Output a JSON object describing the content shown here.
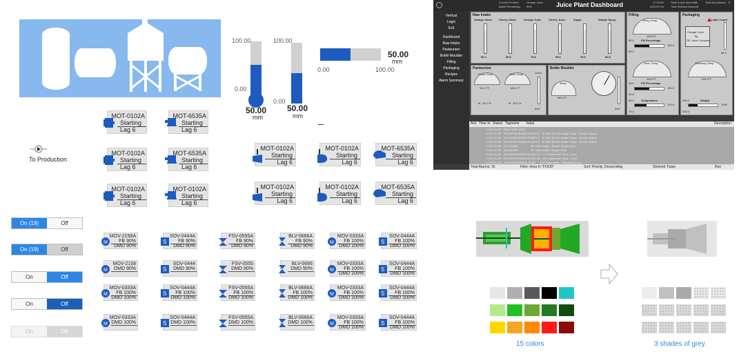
{
  "tanks": {
    "bg": "#87b8ee"
  },
  "level_vertical_1": {
    "top": "100.00",
    "bottom": "0.00",
    "value": "50.00",
    "unit": "mm",
    "fill": 0.5
  },
  "level_vertical_2": {
    "top": "100.00",
    "bottom": "0.00",
    "value": "50.00",
    "unit": "mm",
    "fill": 0.5
  },
  "level_horizontal": {
    "left": "0.00",
    "right": "100.00",
    "value": "50.00",
    "unit": "mm",
    "fill": 0.5
  },
  "to_production": {
    "label": "To Production"
  },
  "motors": [
    {
      "tag": "MOT-0102A",
      "status": "Starting",
      "lag": "Lag 6"
    },
    {
      "tag": "MOT-6535A",
      "status": "Starting",
      "lag": "Lag 6"
    },
    {
      "tag": "MOT-0102A",
      "status": "Starting",
      "lag": "Lag 6"
    },
    {
      "tag": "MOT-6535A",
      "status": "Starting",
      "lag": "Lag 6"
    },
    {
      "tag": "MOT-0102A",
      "status": "Starting",
      "lag": "Lag 6"
    },
    {
      "tag": "MOT-0102A",
      "status": "Starting",
      "lag": "Lag 6"
    },
    {
      "tag": "MOT-0102A",
      "status": "Starting",
      "lag": "Lag 6"
    },
    {
      "tag": "MOT-0102A",
      "status": "Starting",
      "lag": "Lag 6"
    },
    {
      "tag": "MOT-6535A",
      "status": "Starting",
      "lag": "Lag 6"
    },
    {
      "tag": "MOT-0102A",
      "status": "Starting",
      "lag": "Lag 6"
    },
    {
      "tag": "MOT-0102A",
      "status": "Starting",
      "lag": "Lag 6"
    },
    {
      "tag": "MOT-6535A",
      "status": "Starting",
      "lag": "Lag 6"
    }
  ],
  "toggles": [
    {
      "on": "On (19)",
      "off": "Off"
    },
    {
      "on": "On (19)",
      "off": "Off"
    },
    {
      "on": "On",
      "off": "Off"
    },
    {
      "on": "On",
      "off": "Off"
    },
    {
      "on": "On",
      "off": "Off"
    }
  ],
  "valves_row1": [
    {
      "tag": "MOV-2158A",
      "fb": "FB 90%",
      "dmd": "DMD 90%"
    },
    {
      "tag": "SOV-0444A",
      "fb": "FB 90%",
      "dmd": "DMD 90%"
    },
    {
      "tag": "FSV-0555A",
      "fb": "FB 90%",
      "dmd": "DMD 90%"
    },
    {
      "tag": "BLV-0666A",
      "fb": "FB 90%",
      "dmd": "DMD 90%"
    },
    {
      "tag": "MOV-0333A",
      "fb": "FB 100%",
      "dmd": "DMD 100%"
    },
    {
      "tag": "SOV-0444A",
      "fb": "FB 100%",
      "dmd": "DMD 100%"
    }
  ],
  "valves_row2": [
    {
      "tag": "MOV-2158",
      "fb": "DMD 90%"
    },
    {
      "tag": "SOV-0444",
      "fb": "DMD 90%"
    },
    {
      "tag": "FSV-0555",
      "fb": "DMD 90%"
    },
    {
      "tag": "BLV-0666",
      "fb": "DMD 90%"
    },
    {
      "tag": "MOV-0333A",
      "fb": "FB 100%",
      "dmd": "DMD 100%"
    },
    {
      "tag": "SOV-0444A",
      "fb": "FB 100%",
      "dmd": "DMD 100%"
    }
  ],
  "valves_row3": [
    {
      "tag": "MOV-0333A",
      "fb": "FB 100%",
      "dmd": "DMD 100%"
    },
    {
      "tag": "SOV-0444A",
      "fb": "FB 100%",
      "dmd": "DMD 100%"
    },
    {
      "tag": "FSV-0555A",
      "fb": "FB 100%",
      "dmd": "DMD 100%"
    },
    {
      "tag": "BLV-0666A",
      "fb": "FB 100%",
      "dmd": "DMD 100%"
    },
    {
      "tag": "MOV-0333A",
      "fb": "FB 100%",
      "dmd": "DMD 100%"
    },
    {
      "tag": "SOV-0444A",
      "fb": "FB 100%",
      "dmd": "DMD 100%"
    }
  ],
  "valves_row4": [
    {
      "tag": "MOV-0333A",
      "fb": "DMD 100%"
    },
    {
      "tag": "SOV-0444A",
      "fb": "DMD 100%"
    },
    {
      "tag": "FSV-0555A",
      "fb": "DMD 100%"
    },
    {
      "tag": "BLV-0666A",
      "fb": "DMD 100%"
    },
    {
      "tag": "MOV-0333A",
      "fb": "FB 100%",
      "dmd": "DMD 100%"
    },
    {
      "tag": "SOV-0444A",
      "fb": "FB 100%",
      "dmd": "DMD 100%"
    }
  ],
  "dashboard": {
    "title": "Juice Plant Dashboard",
    "product_label": "Current Product:",
    "product": "Orange Juice",
    "batch_label": "Batch Remaining:",
    "batch": "90%",
    "time": "17:04:58",
    "date": "2021/07/14",
    "unack_label": "Total Unack Alarms:",
    "unack": "16",
    "shelved_label": "Total Shelved Alarms:",
    "shelved": "0",
    "ack_label": "Total Ack Alarms:",
    "ack": "0",
    "nav": [
      "Vertical",
      "Login",
      "Exit",
      "Dashboard",
      "Raw Intake",
      "Pasteurizer",
      "Bottle Moulder",
      "Filling",
      "Packaging",
      "Recipes",
      "Alarm Summary"
    ],
    "raw_intake": "Raw Intake",
    "raw_tanks": [
      {
        "name": "Orange Share",
        "val": "80.4"
      },
      {
        "name": "Cherry Share",
        "val": "95.6"
      },
      {
        "name": "Orange Juice",
        "val": "79.8"
      },
      {
        "name": "Cherry Juice",
        "val": "95.6"
      },
      {
        "name": "Sugar",
        "val": "95.6"
      },
      {
        "name": "Simple Syrup",
        "val": "80.8"
      }
    ],
    "filling": "Filling",
    "packaging": "Packaging",
    "slurry_temp": "Slurry Temp",
    "slurry_val": "106.9°F",
    "fill_pct": "Fill Percentage",
    "fill_left": "50.0",
    "fill_right": "100.0",
    "fill_bot": "50.0",
    "label_count": "Label Count",
    "label_box": "Orange Juice",
    "label_by": "By",
    "label_co": "GE Juice Company",
    "label_val": "86.9",
    "juice_temp": "Juice Temp",
    "juice_val": "106.9°F",
    "fill2_left": "49.0",
    "fill2_right": "100.0",
    "fill2_bot": "50.0",
    "shrink_temp": "Shrinking Temp",
    "shrink_val": "209.2°F",
    "temperature": "Temperature",
    "temp_left": "66.0",
    "temp_right": "120.0",
    "temp_bot": "70.0",
    "weight": "Weight",
    "weight_left": "296.2",
    "weight_right": "1000",
    "weight_bot": "200.0",
    "pasteurizer": "Pasteurizer",
    "bottle_moulder": "Bottle Moulder",
    "past_slurry": "Slurry Temp",
    "past_slurry_val": "191.1°F",
    "past_juice": "Juice Temp",
    "past_juice_val": "186.1°F",
    "past_level": "Level",
    "past_level_val": "50.0",
    "past_m": "M",
    "past_m_val": "40.0 %",
    "bm_temp": "Temp",
    "bm_val": "186.1°F",
    "bm_level_val": "50.0",
    "alarm_cols": [
      "Ack",
      "Time In",
      "Status",
      "Tagname",
      "Value",
      "Description"
    ],
    "alarm_rows": [
      "17:03:15 OR   FAIL PUMP (ON)",
      "17:03:15 OR   PA.PASTEURIZER.PUMP1.S   B: 50% 85 Pre-Intake Pump - Service Status",
      "17:03:15 OR   PA.PASTEURIZER.PUMP2.S   B: 50% 85 Pre-Intake Pump - Service Status",
      "17:03:15 OR   PA.PASTEURIZER.PUMP3.S   B: 50% 85 Pre-Intake Pump - Service Status",
      "17:03:15 OR   PA.SUGAR                 88  Raw Intake - Simple Syrup Level",
      "17:03:15 OR   PA.SUGAR                 88  Raw Intake - Sugar Level",
      "17:03:15 OR   PA.PASTEURIZER.LEVEL.PV  77  Pasteurizer Tank - Level",
      "17:03:15 OR   PA.PASTEURIZER.LEVEL.SP  100 Pasteurizer Tank - Level",
      "17:03:15 OR   PA.PASTEURIZER.TEMP      101 Pasteurizer - Shrinking Temp"
    ],
    "footer_total": "Total Alarms: 16",
    "footer_filter": "Filter: Area In \"FOOD\"",
    "footer_sort": "Sort: Priority, Descending",
    "footer_shelved": "Shelved: False",
    "footer_run": "Run"
  },
  "colors_label": "15 colors",
  "greys_label": "3 shades of grey",
  "color_swatches": [
    "#e6e6e6",
    "#b0b0b0",
    "#595959",
    "#000000",
    "#22c4c4",
    "#b5e88d",
    "#22c022",
    "#6ea832",
    "#237a23",
    "#0e4d0e",
    "#ffd700",
    "#f5a623",
    "#ff8a00",
    "#ff1a1a",
    "#8b0a0a"
  ],
  "grey_swatches": [
    "#ececec",
    "#c0c0c0",
    "#a9a9a9",
    "#e8e8e8",
    "#e8e8e8",
    "#d8d8d8",
    "#d8d8d8",
    "#d8d8d8",
    "#d8d8d8",
    "#d8d8d8",
    "#d8d8d8",
    "#d8d8d8",
    "#d8d8d8",
    "#d8d8d8",
    "#d8d8d8"
  ]
}
